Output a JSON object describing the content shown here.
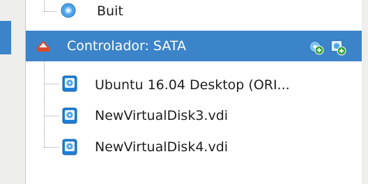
{
  "tree": {
    "items": [
      {
        "label": "Buit",
        "icon": "optical-disc-icon"
      },
      {
        "label": "Controlador: SATA",
        "icon": "controller-icon",
        "selected": true
      },
      {
        "label": "Ubuntu 16.04 Desktop (ORI...",
        "icon": "hard-disk-icon"
      },
      {
        "label": "NewVirtualDisk3.vdi",
        "icon": "hard-disk-icon"
      },
      {
        "label": "NewVirtualDisk4.vdi",
        "icon": "hard-disk-icon"
      }
    ],
    "actions": [
      {
        "name": "add-optical-drive",
        "icon": "add-optical-drive-icon"
      },
      {
        "name": "add-hard-disk",
        "icon": "add-hard-disk-icon"
      }
    ]
  },
  "colors": {
    "selection": "#3c84c9",
    "panel": "#ffffff",
    "window": "#eeeeec"
  }
}
